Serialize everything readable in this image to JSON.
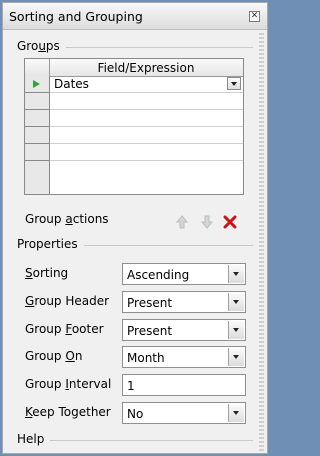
{
  "window": {
    "title": "Sorting and Grouping"
  },
  "groups": {
    "section_pre": "Gro",
    "section_ul": "u",
    "section_post": "ps",
    "column_header": "Field/Expression",
    "rows": [
      {
        "value": "Dates",
        "selected": true
      },
      {
        "value": ""
      },
      {
        "value": ""
      },
      {
        "value": ""
      },
      {
        "value": ""
      }
    ]
  },
  "group_actions": {
    "label_pre": "Group ",
    "label_ul": "a",
    "label_post": "ctions",
    "icons": [
      "move-up-icon",
      "move-down-icon",
      "delete-icon"
    ]
  },
  "properties": {
    "section": "Properties",
    "sorting": {
      "pre": "",
      "ul": "S",
      "post": "orting",
      "value": "Ascending"
    },
    "group_header": {
      "pre": "",
      "ul": "G",
      "post": "roup Header",
      "value": "Present"
    },
    "group_footer": {
      "pre": "Group ",
      "ul": "F",
      "post": "ooter",
      "value": "Present"
    },
    "group_on": {
      "pre": "Group ",
      "ul": "O",
      "post": "n",
      "value": "Month"
    },
    "group_interval": {
      "pre": "Group ",
      "ul": "I",
      "post": "nterval",
      "value": "1"
    },
    "keep_together": {
      "pre": "",
      "ul": "K",
      "post": "eep Together",
      "value": "No"
    }
  },
  "help": {
    "section": "Help"
  },
  "colors": {
    "delete": "#d01010",
    "arrow_disabled": "#c8c8c8",
    "current_row": "#3aa03a"
  }
}
